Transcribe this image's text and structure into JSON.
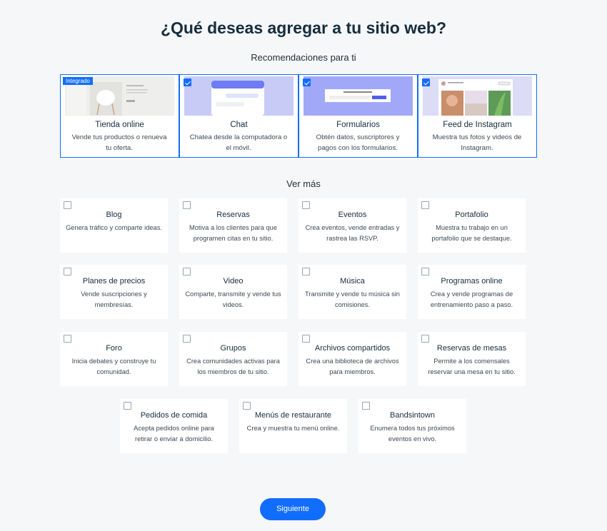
{
  "header": {
    "title": "¿Qué deseas agregar a tu sitio web?",
    "recommendations": "Recomendaciones para ti",
    "see_more": "Ver más"
  },
  "recommended": [
    {
      "title": "Tienda online",
      "desc": "Vende tus productos o renueva tu oferta.",
      "badge": "Integrado",
      "checked": false
    },
    {
      "title": "Chat",
      "desc": "Chatea desde la computadora o el móvil.",
      "checked": true
    },
    {
      "title": "Formularios",
      "desc": "Obtén datos, suscriptores y pagos con los formularios.",
      "checked": true
    },
    {
      "title": "Feed de Instagram",
      "desc": "Muestra tus fotos y videos de Instagram.",
      "checked": true
    }
  ],
  "apps": [
    {
      "title": "Blog",
      "desc": "Genera tráfico y comparte ideas."
    },
    {
      "title": "Reservas",
      "desc": "Motiva a los clientes para que programen citas en tu sitio."
    },
    {
      "title": "Eventos",
      "desc": "Crea eventos, vende entradas y rastrea las RSVP."
    },
    {
      "title": "Portafolio",
      "desc": "Muestra tu trabajo en un portafolio que se destaque."
    },
    {
      "title": "Planes de precios",
      "desc": "Vende suscripciones y membresías."
    },
    {
      "title": "Video",
      "desc": "Comparte, transmite y vende tus videos."
    },
    {
      "title": "Música",
      "desc": "Transmite y vende tu música sin comisiones."
    },
    {
      "title": "Programas online",
      "desc": "Crea y vende programas de entrenamiento paso a paso."
    },
    {
      "title": "Foro",
      "desc": "Inicia debates y construye tu comunidad."
    },
    {
      "title": "Grupos",
      "desc": "Crea comunidades activas para los miembros de tu sitio."
    },
    {
      "title": "Archivos compartidos",
      "desc": "Crea una biblioteca de archivos para miembros."
    },
    {
      "title": "Reservas de mesas",
      "desc": "Permite a los comensales reservar una mesa en tu sitio."
    },
    {
      "title": "Pedidos de comida",
      "desc": "Acepta pedidos online para retirar o enviar a domicilio."
    },
    {
      "title": "Menús de restaurante",
      "desc": "Crea y muestra tu menú online."
    },
    {
      "title": "Bandsintown",
      "desc": "Enumera todos tus próximos eventos en vivo."
    }
  ],
  "footer": {
    "next_label": "Siguiente"
  },
  "colors": {
    "accent": "#116dff"
  }
}
